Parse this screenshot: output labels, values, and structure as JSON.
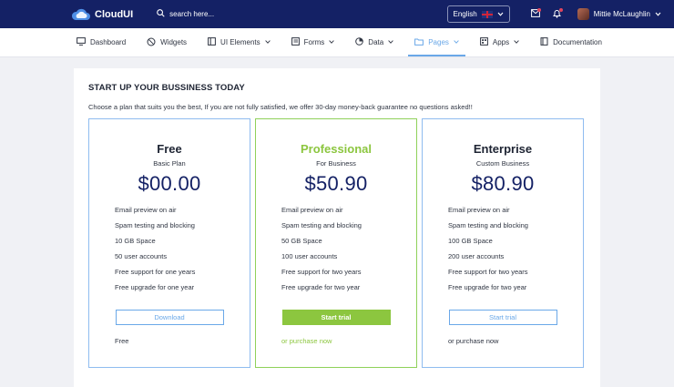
{
  "header": {
    "brand": "CloudUI",
    "search_placeholder": "search here...",
    "language": "English",
    "user_name": "Mittie McLaughlin"
  },
  "nav": [
    {
      "label": "Dashboard",
      "icon": "monitor-icon",
      "dropdown": false,
      "active": false
    },
    {
      "label": "Widgets",
      "icon": "slash-circle-icon",
      "dropdown": false,
      "active": false
    },
    {
      "label": "UI Elements",
      "icon": "columns-icon",
      "dropdown": true,
      "active": false
    },
    {
      "label": "Forms",
      "icon": "list-icon",
      "dropdown": true,
      "active": false
    },
    {
      "label": "Data",
      "icon": "pie-icon",
      "dropdown": true,
      "active": false
    },
    {
      "label": "Pages",
      "icon": "folder-icon",
      "dropdown": true,
      "active": true
    },
    {
      "label": "Apps",
      "icon": "grid-icon",
      "dropdown": true,
      "active": false
    },
    {
      "label": "Documentation",
      "icon": "book-icon",
      "dropdown": false,
      "active": false
    }
  ],
  "page": {
    "title": "START UP YOUR BUSSINESS TODAY",
    "subtitle": "Choose a plan that suits you the best, If you are not fully satisfied, we offer 30-day money-back guarantee no questions asked!!"
  },
  "plans": [
    {
      "name": "Free",
      "tagline": "Basic Plan",
      "price": "$00.00",
      "features": [
        "Email preview on air",
        "Spam testing and blocking",
        "10 GB Space",
        "50 user accounts",
        "Free support for one years",
        "Free upgrade for one year"
      ],
      "button": "Download",
      "footer": "Free"
    },
    {
      "name": "Professional",
      "tagline": "For Business",
      "price": "$50.90",
      "features": [
        "Email preview on air",
        "Spam testing and blocking",
        "50 GB Space",
        "100 user accounts",
        "Free support for two years",
        "Free upgrade for two year"
      ],
      "button": "Start trial",
      "footer": "or purchase now"
    },
    {
      "name": "Enterprise",
      "tagline": "Custom Business",
      "price": "$80.90",
      "features": [
        "Email preview on air",
        "Spam testing and blocking",
        "100 GB Space",
        "200 user accounts",
        "Free support for two years",
        "Free upgrade for two year"
      ],
      "button": "Start trial",
      "footer": "or purchase now"
    }
  ],
  "colors": {
    "topbar": "#142165",
    "accent_blue": "#6aa8e8",
    "accent_green": "#8cc63f"
  }
}
